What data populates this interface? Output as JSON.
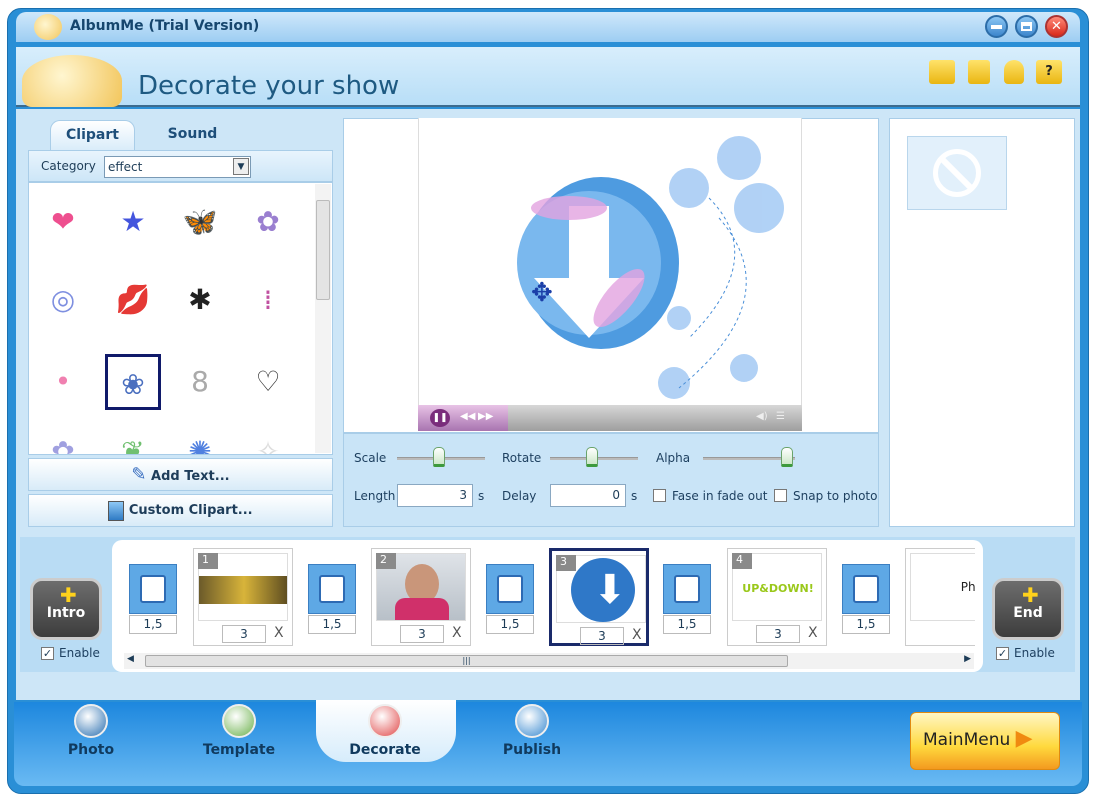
{
  "window": {
    "title": "AlbumMe (Trial Version)",
    "controls": [
      "minimize",
      "restore",
      "close"
    ]
  },
  "header": {
    "title": "Decorate your show",
    "toolbar_icons": [
      "folder-open-icon",
      "save-icon",
      "user-icon",
      "help-icon"
    ],
    "help_glyph": "?"
  },
  "left_panel": {
    "tabs": [
      {
        "label": "Clipart",
        "active": true
      },
      {
        "label": "Sound",
        "active": false
      }
    ],
    "category_label": "Category",
    "category_value": "effect",
    "clipart": [
      {
        "icon": "heart",
        "glyph": "❤",
        "color": "#ee4f8f"
      },
      {
        "icon": "stars",
        "glyph": "★",
        "color": "#4455dd"
      },
      {
        "icon": "butterfly",
        "glyph": "🦋",
        "color": "#c0392b"
      },
      {
        "icon": "confetti",
        "glyph": "✿",
        "color": "#9a7fd0"
      },
      {
        "icon": "rings",
        "glyph": "◎",
        "color": "#7e8fe0"
      },
      {
        "icon": "lips",
        "glyph": "💋",
        "color": "#e0409a"
      },
      {
        "icon": "ant",
        "glyph": "✱",
        "color": "#222222"
      },
      {
        "icon": "hanging-drops",
        "glyph": "⁞",
        "color": "#c050a0"
      },
      {
        "icon": "petals",
        "glyph": "•",
        "color": "#f080b0"
      },
      {
        "icon": "flowers",
        "glyph": "❀",
        "color": "#4a6fbf",
        "selected": true
      },
      {
        "icon": "outline-shape",
        "glyph": "8",
        "color": "#aaaaaa"
      },
      {
        "icon": "hearts-outline",
        "glyph": "♡",
        "color": "#333333"
      },
      {
        "icon": "flower-small",
        "glyph": "✿",
        "color": "#a0a0e0"
      },
      {
        "icon": "leaf",
        "glyph": "❦",
        "color": "#70c070"
      },
      {
        "icon": "splash",
        "glyph": "✺",
        "color": "#5080e0"
      },
      {
        "icon": "sparkle",
        "glyph": "✧",
        "color": "#dddddd"
      }
    ],
    "add_text_label": "Add Text...",
    "custom_clipart_label": "Custom Clipart..."
  },
  "controls": {
    "scale_label": "Scale",
    "scale_value": 0.5,
    "rotate_label": "Rotate",
    "rotate_value": 0.5,
    "alpha_label": "Alpha",
    "alpha_value": 1.0,
    "length_label": "Length",
    "length_value": "3",
    "delay_label": "Delay",
    "delay_value": "0",
    "unit": "s",
    "fade_label": "Fase in fade out",
    "fade_checked": false,
    "snap_label": "Snap to photo",
    "snap_checked": false
  },
  "timeline": {
    "intro_label": "Intro",
    "end_label": "End",
    "enable_label": "Enable",
    "intro_enabled": true,
    "end_enabled": true,
    "transitions": [
      "1,5",
      "1,5",
      "1,5",
      "1,5",
      "1,5"
    ],
    "slides": [
      {
        "num": "1",
        "duration": "3",
        "thumb": "yellow car"
      },
      {
        "num": "2",
        "duration": "3",
        "thumb": "person"
      },
      {
        "num": "3",
        "duration": "3",
        "thumb": "down arrow",
        "selected": true
      },
      {
        "num": "4",
        "duration": "3",
        "thumb": "UP&DOWN!"
      },
      {
        "label": "Photo"
      }
    ],
    "close_glyph": "X"
  },
  "nav": {
    "items": [
      {
        "label": "Photo"
      },
      {
        "label": "Template"
      },
      {
        "label": "Decorate",
        "active": true
      },
      {
        "label": "Publish"
      }
    ],
    "main_menu_label": "MainMenu"
  },
  "colors": {
    "frame": "#2a8fd6",
    "panel": "#cde6f7",
    "accent": "#ffd93d"
  }
}
